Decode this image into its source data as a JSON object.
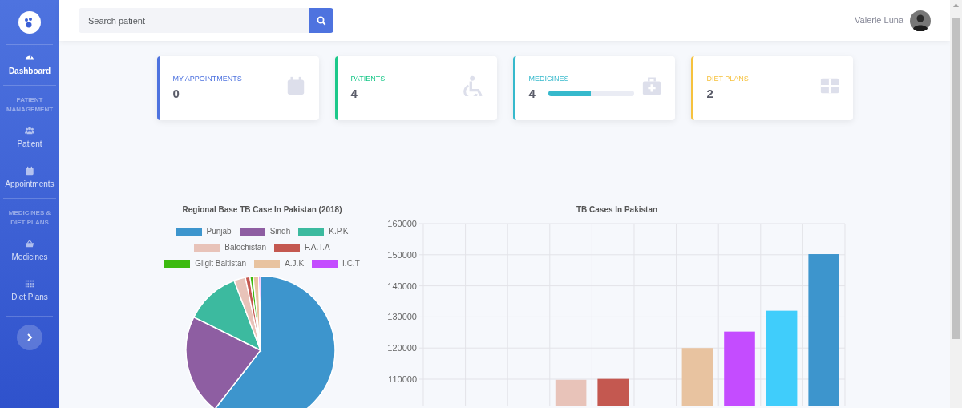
{
  "sidebar": {
    "items": [
      {
        "kind": "link",
        "label": "Dashboard",
        "selected": true
      },
      {
        "kind": "heading",
        "label": "PATIENT MANAGEMENT"
      },
      {
        "kind": "link",
        "label": "Patient",
        "selected": false
      },
      {
        "kind": "link",
        "label": "Appointments",
        "selected": false
      },
      {
        "kind": "heading",
        "label": "MEDICINES & DIET PLANS"
      },
      {
        "kind": "link",
        "label": "Medicines",
        "selected": false
      },
      {
        "kind": "link",
        "label": "Diet Plans",
        "selected": false
      }
    ]
  },
  "topbar": {
    "search": {
      "placeholder": "Search patient"
    },
    "user": {
      "name": "Valerie Luna"
    }
  },
  "stat_cards": [
    {
      "title": "MY APPOINTMENTS",
      "value": "0",
      "color": "#4e73df"
    },
    {
      "title": "PATIENTS",
      "value": "4",
      "color": "#1cc88a"
    },
    {
      "title": "MEDICINES",
      "value": "4",
      "color": "#36b9cc",
      "level": 0.5
    },
    {
      "title": "DIET PLANS",
      "value": "2",
      "color": "#f6c23e"
    }
  ],
  "pie_chart": {
    "chart_data": {
      "type": "pie",
      "title": "Regional Base TB Case In Pakistan (2018)",
      "legend": "top",
      "categories": [
        "Punjab",
        "Sindh",
        "K.P.K",
        "Balochistan",
        "F.A.T.A",
        "Gilgit Baltistan",
        "A.J.K",
        "I.C.T"
      ],
      "values": [
        61,
        22,
        12,
        2.5,
        1,
        0.7,
        1.2,
        0.4
      ],
      "colors": [
        "#3d95cd",
        "#8e5ea2",
        "#3cba9f",
        "#e8c3b9",
        "#c45850",
        "#3cba10",
        "#e8c3a0",
        "#c44cff"
      ]
    }
  },
  "bar_chart": {
    "chart_data": {
      "type": "bar",
      "title": "TB Cases In Pakistan",
      "grid": true,
      "values": [
        null,
        null,
        null,
        109800,
        110100,
        null,
        120000,
        125300,
        132000,
        150200
      ],
      "colors": [
        null,
        null,
        null,
        "#e8c3b9",
        "#c45850",
        null,
        "#e8c3a0",
        "#c44cff",
        "#40cdfb",
        "#3d95cd"
      ],
      "ylim": [
        101500,
        160000
      ],
      "yticks": [
        110000,
        120000,
        130000,
        140000,
        150000,
        160000
      ]
    }
  }
}
